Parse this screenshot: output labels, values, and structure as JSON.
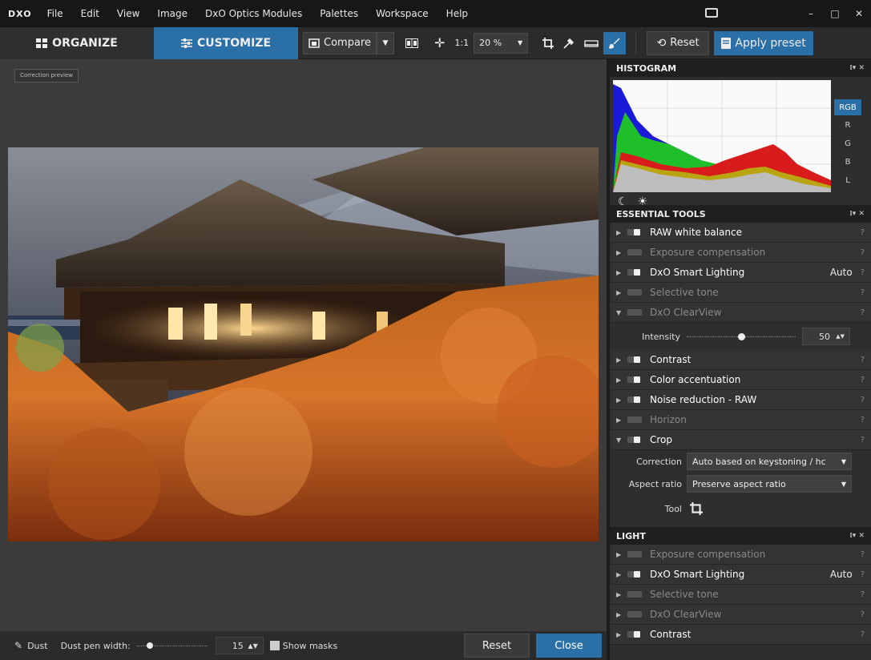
{
  "app": {
    "logo": "DXO",
    "menu": [
      "File",
      "Edit",
      "View",
      "Image",
      "DxO Optics Modules",
      "Palettes",
      "Workspace",
      "Help"
    ],
    "window_controls": {
      "minimize": "–",
      "maximize": "□",
      "close": "✕"
    }
  },
  "toolbar": {
    "organize_label": "ORGANIZE",
    "customize_label": "CUSTOMIZE",
    "compare_label": "Compare",
    "one_to_one": "1:1",
    "zoom": "20 %",
    "reset_label": "Reset",
    "apply_preset_label": "Apply preset"
  },
  "viewer": {
    "preview_badge": "Correction preview"
  },
  "bottom_tool": {
    "tool_name": "Dust",
    "pen_width_label": "Dust pen width:",
    "pen_width_value": "15",
    "pen_width_fraction": 0.15,
    "show_masks_label": "Show masks",
    "reset_label": "Reset",
    "close_label": "Close"
  },
  "histogram": {
    "title": "HISTOGRAM",
    "channels": [
      "RGB",
      "R",
      "G",
      "B",
      "L"
    ],
    "active_channel": "RGB",
    "icons": [
      "moon-icon",
      "sun-icon"
    ]
  },
  "essential_tools": {
    "title": "ESSENTIAL TOOLS",
    "items": [
      {
        "label": "RAW white balance",
        "enabled": true,
        "expanded": false,
        "extra": ""
      },
      {
        "label": "Exposure compensation",
        "enabled": false,
        "expanded": false,
        "extra": ""
      },
      {
        "label": "DxO Smart Lighting",
        "enabled": true,
        "expanded": false,
        "extra": "Auto"
      },
      {
        "label": "Selective tone",
        "enabled": false,
        "expanded": false,
        "extra": ""
      },
      {
        "label": "DxO ClearView",
        "enabled": false,
        "expanded": true,
        "extra": ""
      },
      {
        "label": "Contrast",
        "enabled": true,
        "expanded": false,
        "extra": ""
      },
      {
        "label": "Color accentuation",
        "enabled": true,
        "expanded": false,
        "extra": ""
      },
      {
        "label": "Noise reduction - RAW",
        "enabled": true,
        "expanded": false,
        "extra": ""
      },
      {
        "label": "Horizon",
        "enabled": false,
        "expanded": false,
        "extra": ""
      },
      {
        "label": "Crop",
        "enabled": true,
        "expanded": true,
        "extra": ""
      }
    ],
    "clearview_intensity_label": "Intensity",
    "clearview_intensity_value": "50",
    "clearview_intensity_fraction": 0.5,
    "crop_correction_label": "Correction",
    "crop_correction_value": "Auto based on keystoning / hc",
    "crop_aspect_label": "Aspect ratio",
    "crop_aspect_value": "Preserve aspect ratio",
    "crop_tool_label": "Tool",
    "help": "?"
  },
  "light": {
    "title": "LIGHT",
    "items": [
      {
        "label": "Exposure compensation",
        "enabled": false,
        "extra": ""
      },
      {
        "label": "DxO Smart Lighting",
        "enabled": true,
        "extra": "Auto"
      },
      {
        "label": "Selective tone",
        "enabled": false,
        "extra": ""
      },
      {
        "label": "DxO ClearView",
        "enabled": false,
        "extra": ""
      },
      {
        "label": "Contrast",
        "enabled": true,
        "extra": ""
      }
    ]
  },
  "colors": {
    "accent": "#2a6fa6",
    "panel_bg": "#2e2e2e",
    "viewer_bg": "#3b3b3b"
  }
}
